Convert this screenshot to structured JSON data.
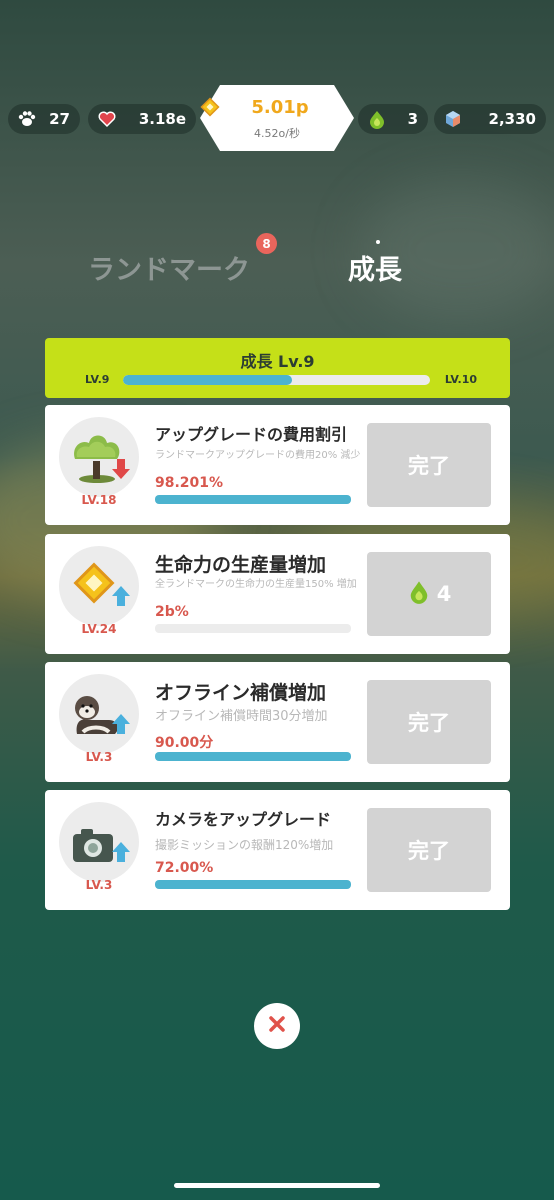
{
  "resources": {
    "paws": "27",
    "hearts": "3.18e",
    "main": "5.01p",
    "main_rate": "4.52o/秒",
    "drops": "3",
    "gems": "2,330"
  },
  "tabs": {
    "landmark": "ランドマーク",
    "landmark_badge": "8",
    "growth": "成長"
  },
  "growth_level": {
    "title": "成長 Lv.9",
    "current": "LV.9",
    "next": "LV.10",
    "progress": 0.55
  },
  "upgrades": [
    {
      "level": "LV.18",
      "title": "アップグレードの費用割引",
      "desc": "ランドマークアップグレードの費用20% 減少",
      "value": "98.201%",
      "progress": 1.0,
      "button": "完了",
      "icon": "tree-down-icon"
    },
    {
      "level": "LV.24",
      "title": "生命力の生産量増加",
      "desc": "全ランドマークの生命力の生産量150% 増加",
      "value": "2b%",
      "progress": 0.0,
      "button": "4",
      "icon": "diamond-up-icon"
    },
    {
      "level": "LV.3",
      "title": "オフライン補償増加",
      "desc": "オフライン補償時間30分増加",
      "value": "90.00分",
      "progress": 1.0,
      "button": "完了",
      "icon": "ferret-up-icon"
    },
    {
      "level": "LV.3",
      "title": "カメラをアップグレード",
      "desc": "撮影ミッションの報酬120%増加",
      "value": "72.00%",
      "progress": 1.0,
      "button": "完了",
      "icon": "camera-up-icon"
    }
  ],
  "colors": {
    "accent_green": "#c5e018",
    "progress_blue": "#4cb3cf",
    "level_red": "#d8584e",
    "gold": "#f0a81c",
    "badge_red": "#e9655c"
  }
}
